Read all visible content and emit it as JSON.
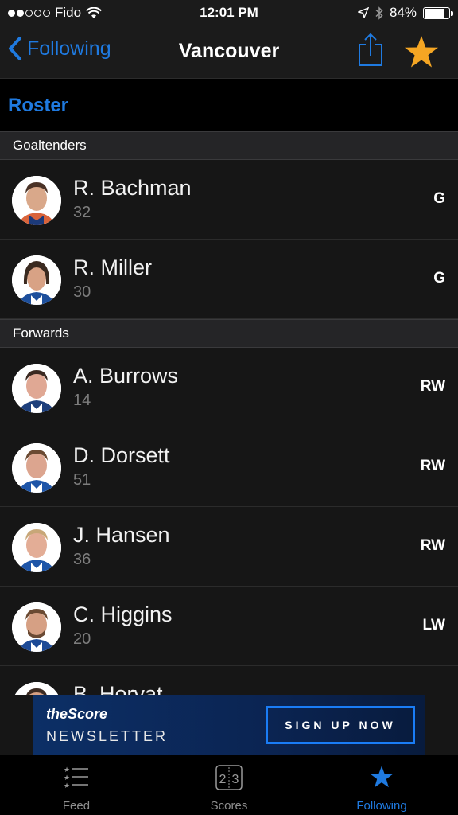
{
  "status_bar": {
    "signal_bars_filled": 2,
    "signal_bars_total": 5,
    "carrier": "Fido",
    "time": "12:01 PM",
    "battery_percent": "84%",
    "battery_level": 0.84
  },
  "nav": {
    "back_label": "Following",
    "title": "Vancouver",
    "accent_color": "#1f7ae0",
    "star_color": "#f5a623"
  },
  "roster": {
    "title": "Roster"
  },
  "sections": [
    {
      "header": "Goaltenders",
      "players": [
        {
          "name": "R. Bachman",
          "number": "32",
          "position": "G"
        },
        {
          "name": "R. Miller",
          "number": "30",
          "position": "G"
        }
      ]
    },
    {
      "header": "Forwards",
      "players": [
        {
          "name": "A. Burrows",
          "number": "14",
          "position": "RW"
        },
        {
          "name": "D. Dorsett",
          "number": "51",
          "position": "RW"
        },
        {
          "name": "J. Hansen",
          "number": "36",
          "position": "RW"
        },
        {
          "name": "C. Higgins",
          "number": "20",
          "position": "LW"
        },
        {
          "name": "B. Horvat",
          "number": "",
          "position": ""
        }
      ]
    }
  ],
  "ad": {
    "brand": "theScore",
    "subtitle": "NEWSLETTER",
    "cta": "SIGN UP NOW"
  },
  "tabbar": {
    "tabs": [
      {
        "label": "Feed",
        "icon": "feed-list-icon",
        "active": false
      },
      {
        "label": "Scores",
        "icon": "scoreboard-icon",
        "active": false
      },
      {
        "label": "Following",
        "icon": "star-icon",
        "active": true
      }
    ],
    "scores_icon_left": "2",
    "scores_icon_right": "3"
  }
}
